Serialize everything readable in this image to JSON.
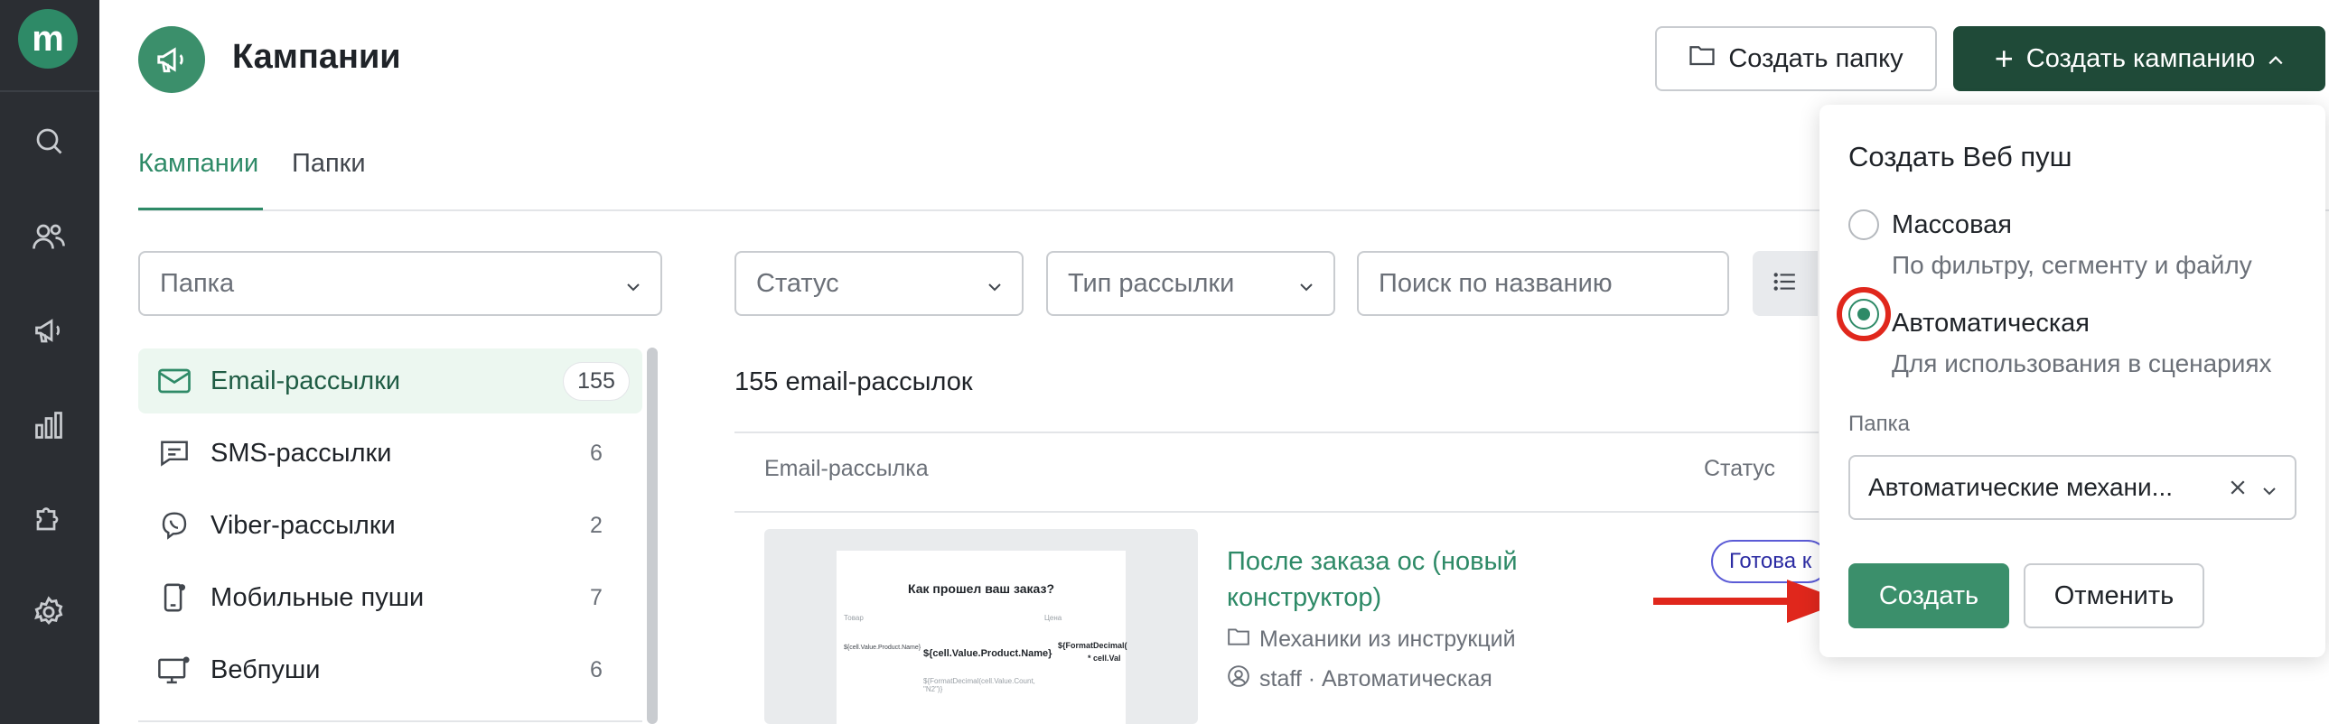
{
  "app": {
    "logo_letter": "m"
  },
  "rail": {
    "items": [
      "search-icon",
      "users-icon",
      "megaphone-icon",
      "chart-icon",
      "puzzle-icon",
      "gear-icon"
    ]
  },
  "header": {
    "title": "Кампании",
    "create_folder_label": "Создать папку",
    "create_campaign_label": "Создать кампанию"
  },
  "tabs": [
    {
      "label": "Кампании",
      "active": true
    },
    {
      "label": "Папки",
      "active": false
    }
  ],
  "filters": {
    "folder_placeholder": "Папка",
    "status_placeholder": "Статус",
    "type_placeholder": "Тип рассылки",
    "search_placeholder": "Поиск по названию"
  },
  "sidebar": {
    "items": [
      {
        "label": "Email-рассылки",
        "count": "155",
        "icon": "mail-icon",
        "active": true
      },
      {
        "label": "SMS-рассылки",
        "count": "6",
        "icon": "message-icon"
      },
      {
        "label": "Viber-рассылки",
        "count": "2",
        "icon": "viber-icon"
      },
      {
        "label": "Мобильные пуши",
        "count": "7",
        "icon": "mobile-push-icon"
      },
      {
        "label": "Вебпуши",
        "count": "6",
        "icon": "monitor-icon"
      }
    ]
  },
  "main": {
    "count_title": "155 email-рассылок",
    "columns": {
      "name": "Email-рассылка",
      "status": "Статус"
    },
    "rows": [
      {
        "name": "После заказа ос (новый конструктор)",
        "folder": "Механики из инструкций",
        "author": "staff · Автоматическая",
        "status": "Готова к",
        "thumb": {
          "title": "Как прошел ваш заказ?",
          "col1": "Товар",
          "col2": "Цена",
          "img_alt": "${cell.Value.Product.Name}",
          "product": "${cell.Value.Product.Name}",
          "price": "${FormatDecimal(",
          "price2": "* cell.Val",
          "note": "${FormatDecimal(cell.Value.Count, \"N2\")}"
        }
      }
    ]
  },
  "popover": {
    "title": "Создать Веб пуш",
    "options": [
      {
        "label": "Массовая",
        "description": "По фильтру, сегменту и файлу",
        "selected": false
      },
      {
        "label": "Автоматическая",
        "description": "Для использования в сценариях",
        "selected": true
      }
    ],
    "folder_label": "Папка",
    "folder_value": "Автоматические механи...",
    "create_label": "Создать",
    "cancel_label": "Отменить"
  },
  "colors": {
    "accent": "#2e8a67",
    "dark_accent": "#1f4a38",
    "rail": "#2b2e33",
    "highlight": "#e0271c"
  }
}
